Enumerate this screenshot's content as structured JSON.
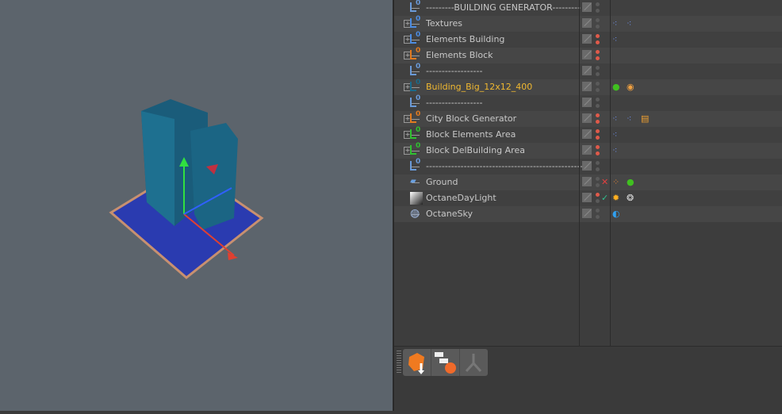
{
  "objects": [
    {
      "name": "---------BUILDING GENERATOR---------",
      "icon": "null-icon",
      "color": "#6a9ad8",
      "expandable": false,
      "dots": [
        "gray",
        "gray"
      ],
      "tags": []
    },
    {
      "name": "Textures",
      "icon": "null-icon",
      "color": "#4d8ce0",
      "expandable": true,
      "dots": [
        "gray",
        "gray"
      ],
      "tags": [
        "cloner-tag",
        "cloner-tag"
      ]
    },
    {
      "name": "Elements Building",
      "icon": "null-icon",
      "color": "#4d8ce0",
      "expandable": true,
      "dots": [
        "red",
        "red"
      ],
      "tags": [
        "cloner-tag"
      ]
    },
    {
      "name": "Elements Block",
      "icon": "null-icon",
      "color": "#e07a20",
      "expandable": true,
      "dots": [
        "red",
        "red"
      ],
      "tags": []
    },
    {
      "name": "------------------",
      "icon": "null-icon",
      "color": "#6a9ad8",
      "expandable": false,
      "dots": [
        "gray",
        "gray"
      ],
      "tags": []
    },
    {
      "name": "Building_Big_12x12_400",
      "icon": "null-icon",
      "color": "#1a6a8a",
      "expandable": true,
      "selected": true,
      "dots": [
        "gray",
        "gray"
      ],
      "tags": [
        "material-tag",
        "display-tag"
      ]
    },
    {
      "name": "------------------",
      "icon": "null-icon",
      "color": "#6a9ad8",
      "expandable": false,
      "dots": [
        "gray",
        "gray"
      ],
      "tags": []
    },
    {
      "name": "City Block Generator",
      "icon": "null-icon",
      "color": "#e07a20",
      "expandable": true,
      "dots": [
        "red",
        "red"
      ],
      "tags": [
        "cloner-tag",
        "cloner-tag",
        "note-tag"
      ]
    },
    {
      "name": "Block Elements Area",
      "icon": "null-icon",
      "color": "#30c030",
      "expandable": true,
      "dots": [
        "red",
        "red"
      ],
      "tags": [
        "cloner-tag"
      ]
    },
    {
      "name": "Block DelBuilding Area",
      "icon": "null-icon",
      "color": "#30c030",
      "expandable": true,
      "dots": [
        "red",
        "red"
      ],
      "tags": [
        "cloner-tag"
      ]
    },
    {
      "name": "---------------------------------------------------",
      "icon": "null-icon",
      "color": "#6a9ad8",
      "expandable": false,
      "dots": [
        "gray",
        "gray"
      ],
      "tags": []
    },
    {
      "name": "Ground",
      "icon": "plane-icon",
      "color": "#6aa0e0",
      "expandable": false,
      "dots": [
        "gray",
        "gray"
      ],
      "status": "✕",
      "status_color": "#e04040",
      "tags": [
        "octane-object-tag",
        "material-tag"
      ]
    },
    {
      "name": "OctaneDayLight",
      "icon": "daylight-icon",
      "color": "#ffffff",
      "expandable": false,
      "dots": [
        "red",
        "gray"
      ],
      "status": "✓",
      "status_color": "#30c090",
      "tags": [
        "sun-tag",
        "light-tag"
      ]
    },
    {
      "name": "OctaneSky",
      "icon": "sky-icon",
      "color": "#a0b8e0",
      "expandable": false,
      "dots": [
        "gray",
        "gray"
      ],
      "tags": [
        "environment-tag"
      ]
    }
  ],
  "colors": {
    "selected_text": "#f0b830",
    "text": "#c8c8c8",
    "viewport": "#5c646c"
  },
  "toolbar": [
    "convert-object-icon",
    "hierarchy-icon",
    "bone-icon"
  ]
}
